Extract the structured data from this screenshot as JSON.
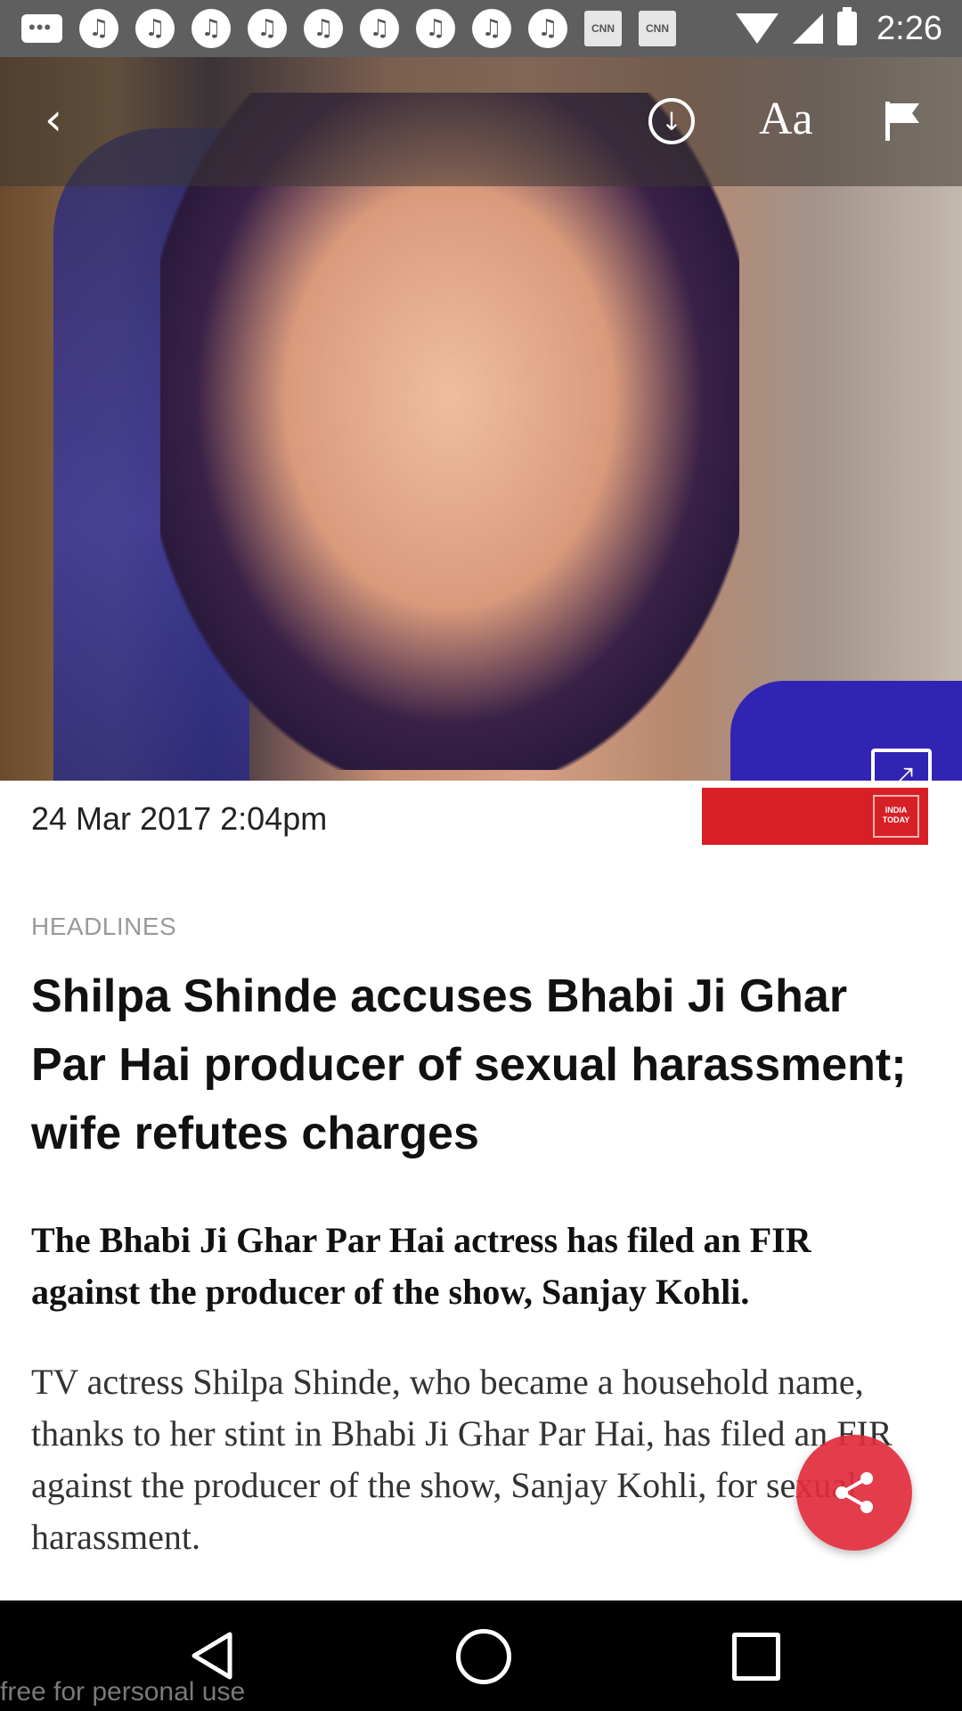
{
  "status_bar": {
    "time": "2:26",
    "notification_icons": [
      "messages-icon",
      "app-icon",
      "app-icon",
      "app-icon",
      "app-icon",
      "app-icon",
      "app-icon",
      "app-icon",
      "app-icon",
      "app-icon",
      "cnn-icon",
      "cnn-icon"
    ],
    "cnn_label": "CNN"
  },
  "toolbar": {
    "back_icon": "back-arrow-icon",
    "download_icon": "download-icon",
    "font_size_label": "Aa",
    "flag_icon": "flag-icon"
  },
  "hero": {
    "expand_icon": "expand-icon"
  },
  "article": {
    "date": "24 Mar 2017 2:04pm",
    "source_logo": "INDIA TODAY",
    "source_color": "#d71f26",
    "category": "HEADLINES",
    "title": "Shilpa Shinde accuses Bhabi Ji Ghar Par Hai producer of sexual harassment; wife refutes charges",
    "summary": "The Bhabi Ji Ghar Par Hai actress has filed an FIR against the producer of the show, Sanjay Kohli.",
    "body": "TV actress Shilpa Shinde, who became a household name, thanks to her stint in Bhabi Ji Ghar Par Hai, has filed an FIR against the producer of the show, Sanjay Kohli, for sexual harassment."
  },
  "share": {
    "icon": "share-icon",
    "color": "#e12d3c"
  },
  "nav_bar": {
    "back_icon": "nav-back-icon",
    "home_icon": "nav-home-icon",
    "recents_icon": "nav-recents-icon"
  },
  "watermark": "free for personal use"
}
